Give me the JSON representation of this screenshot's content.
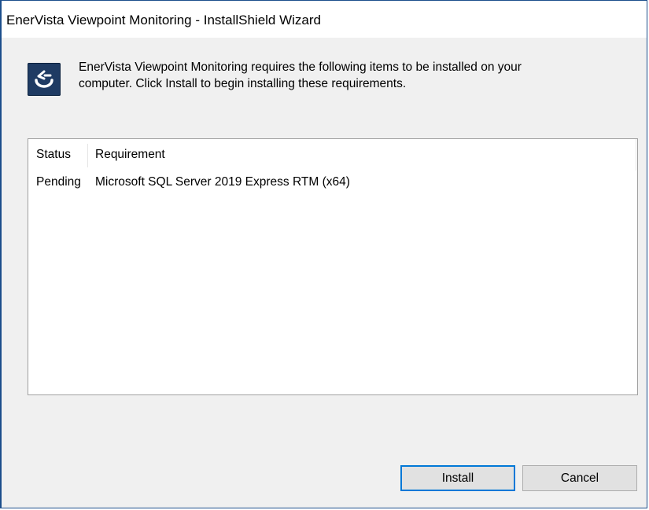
{
  "window": {
    "title": "EnerVista Viewpoint Monitoring - InstallShield Wizard"
  },
  "header": {
    "icon": "installshield-app-icon",
    "description_line1": "EnerVista Viewpoint Monitoring requires the following items to be installed on your",
    "description_line2": "computer. Click Install to begin installing these requirements."
  },
  "requirements": {
    "columns": [
      "Status",
      "Requirement"
    ],
    "rows": [
      {
        "status": "Pending",
        "requirement": "Microsoft SQL Server 2019 Express RTM (x64)"
      }
    ]
  },
  "buttons": {
    "install_label": "Install",
    "cancel_label": "Cancel"
  },
  "colors": {
    "focus_border": "#0078d7",
    "window_border": "#1c4e8c",
    "icon_background": "#1f3b63"
  }
}
